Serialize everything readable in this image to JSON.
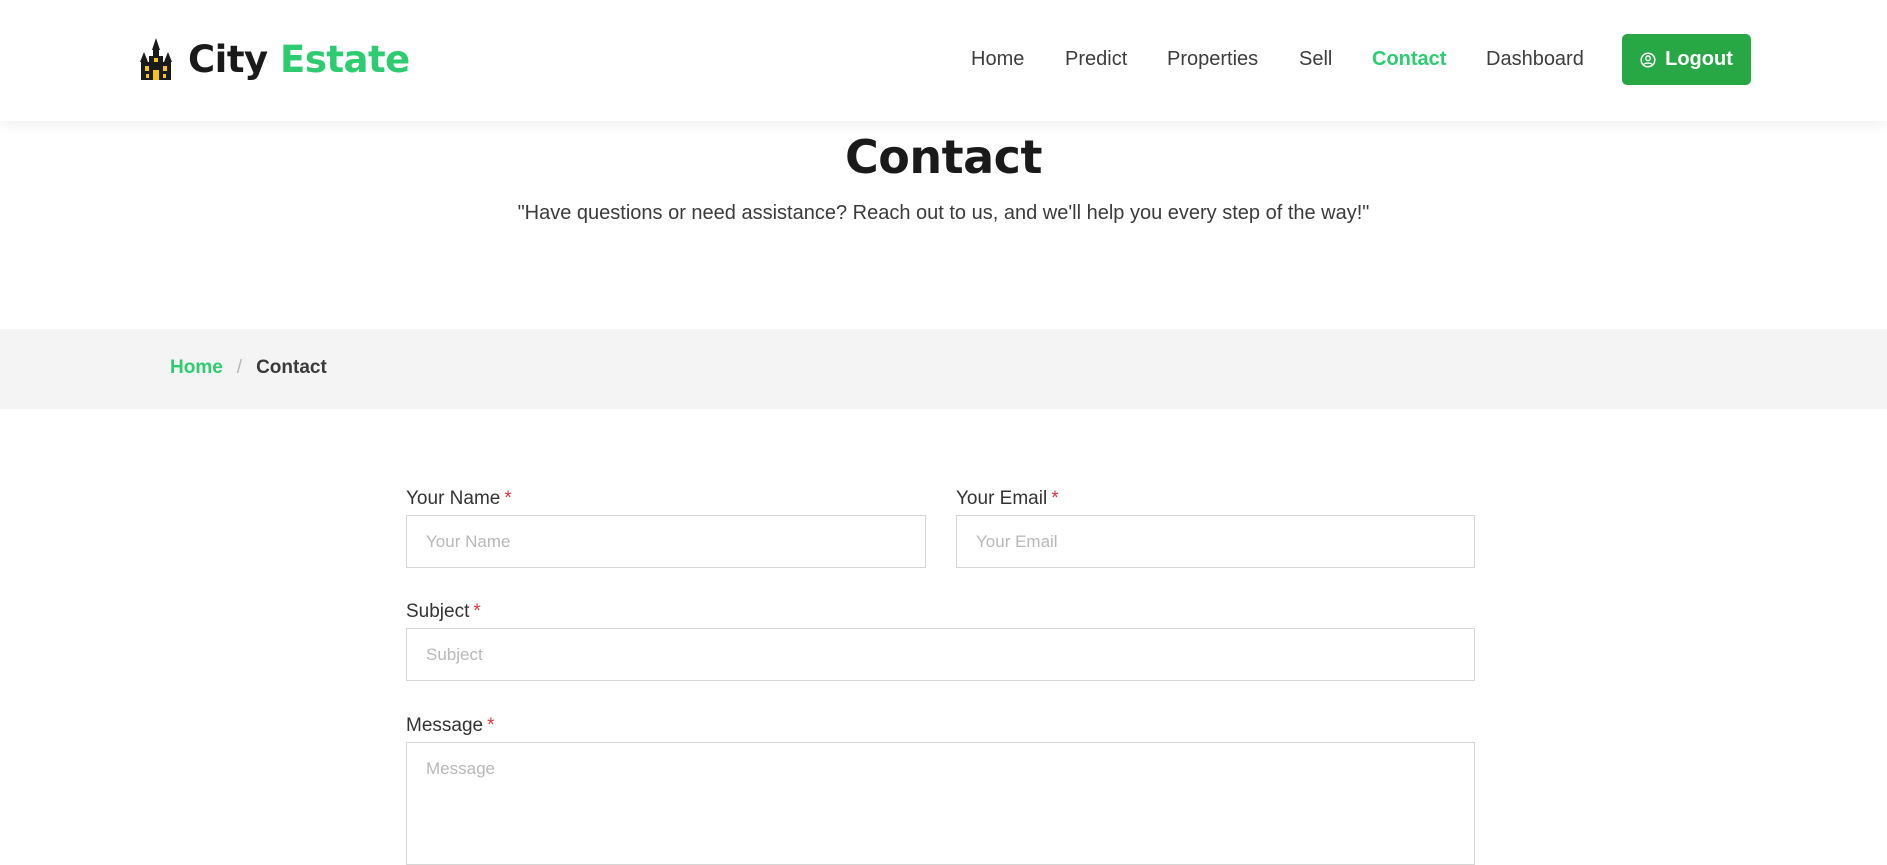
{
  "brand": {
    "name_part1": "City",
    "name_part2": "Estate",
    "icon": "haunted-house-icon",
    "accent_color": "#2ecc71"
  },
  "nav": {
    "items": [
      {
        "label": "Home",
        "active": false
      },
      {
        "label": "Predict",
        "active": false
      },
      {
        "label": "Properties",
        "active": false
      },
      {
        "label": "Sell",
        "active": false
      },
      {
        "label": "Contact",
        "active": true
      },
      {
        "label": "Dashboard",
        "active": false
      }
    ],
    "logout_label": "Logout",
    "logout_icon": "user-circle-icon",
    "logout_color": "#28a745"
  },
  "hero": {
    "title": "Contact",
    "subtitle": "\"Have questions or need assistance? Reach out to us, and we'll help you every step of the way!\""
  },
  "breadcrumb": {
    "home": "Home",
    "separator": "/",
    "current": "Contact"
  },
  "form": {
    "required_marker": "*",
    "name": {
      "label": "Your Name",
      "placeholder": "Your Name",
      "value": ""
    },
    "email": {
      "label": "Your Email",
      "placeholder": "Your Email",
      "value": ""
    },
    "subject": {
      "label": "Subject",
      "placeholder": "Subject",
      "value": ""
    },
    "message": {
      "label": "Message",
      "placeholder": "Message",
      "value": ""
    }
  }
}
